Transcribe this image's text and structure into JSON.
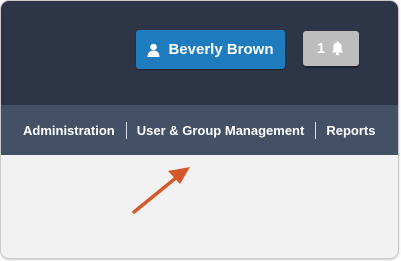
{
  "header": {
    "user_button": {
      "label": "Beverly Brown",
      "icon": "user-icon"
    },
    "notifications": {
      "count": "1",
      "icon": "bell-icon"
    }
  },
  "navbar": {
    "items": [
      {
        "label": "Administration"
      },
      {
        "label": "User & Group Management"
      },
      {
        "label": "Reports"
      }
    ]
  },
  "annotation": {
    "arrow_color": "#d4582a"
  },
  "colors": {
    "header_bg": "#2d3546",
    "navbar_bg": "#435066",
    "primary_button": "#1e7bbd",
    "notification_button": "#bdbdbd",
    "content_bg": "#f2f2f2"
  }
}
